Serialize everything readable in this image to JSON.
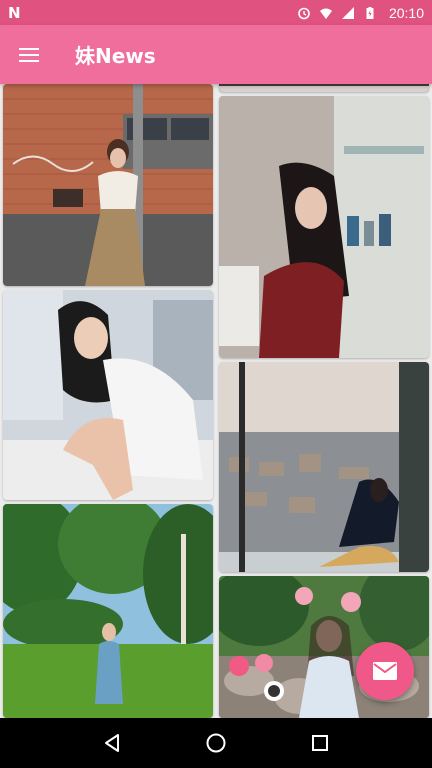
{
  "status_bar": {
    "left_icon": "N",
    "icons": [
      "alarm-icon",
      "wifi-icon",
      "signal-icon",
      "battery-icon"
    ],
    "time": "20:10"
  },
  "app_bar": {
    "title": "妹News",
    "menu_icon": "hamburger-menu-icon"
  },
  "gallery": {
    "items": [
      {
        "column": "left",
        "subject": "photo-woman-brick-wall"
      },
      {
        "column": "left",
        "subject": "photo-woman-sitting-white-dress"
      },
      {
        "column": "left",
        "subject": "photo-woman-in-park"
      },
      {
        "column": "right",
        "subject": "photo-partial-top"
      },
      {
        "column": "right",
        "subject": "photo-woman-red-pajamas"
      },
      {
        "column": "right",
        "subject": "photo-woman-window-city"
      },
      {
        "column": "right",
        "subject": "photo-woman-flowers-rocks"
      }
    ]
  },
  "fab": {
    "icon": "mail-icon"
  },
  "nav_bar": {
    "buttons": [
      "back-icon",
      "home-icon",
      "recents-icon"
    ]
  },
  "colors": {
    "status_bar": "#e0527f",
    "app_bar": "#ef6e9b",
    "fab": "#f0588a",
    "background": "#ececec"
  }
}
